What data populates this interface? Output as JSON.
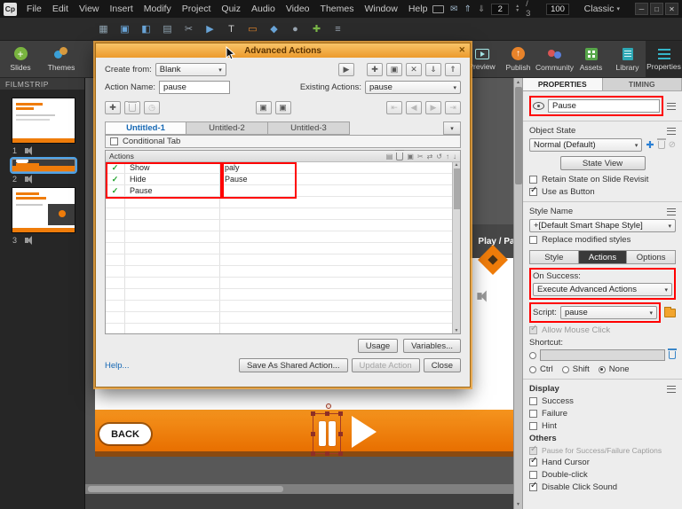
{
  "icons": {
    "dropdown": "▾",
    "check": "✓",
    "play": "▶",
    "plus": "✚",
    "copy": "▣",
    "delete": "✕",
    "clock": "◷",
    "cut": "✂",
    "undo": "↺",
    "list": "▤",
    "swap": "⇄",
    "slash": "⊘",
    "nav_first": "⇤",
    "nav_prev": "◀",
    "nav_next": "▶",
    "nav_last": "⇥",
    "up": "↑",
    "down": "↓",
    "import": "⇓",
    "export": "⇑",
    "mail": "✉",
    "win_min": "─",
    "win_max": "□",
    "win_close": "✕",
    "scroll_up": "▲",
    "scroll_down": "▼",
    "step_up": "▲",
    "step_down": "▼"
  },
  "quick_icons": [
    "▦",
    "▣",
    "◧",
    "▤",
    "✂",
    "▶",
    "T",
    "▭",
    "◆",
    "●",
    "✚",
    "≡"
  ],
  "menubar": {
    "logo": "Cp",
    "items": [
      "File",
      "Edit",
      "View",
      "Insert",
      "Modify",
      "Project",
      "Quiz",
      "Audio",
      "Video",
      "Themes",
      "Window",
      "Help"
    ],
    "slide_current": "2",
    "slide_total": "/ 3",
    "zoom": "100",
    "workspace": "Classic"
  },
  "toolbar": {
    "slides": "Slides",
    "themes": "Themes",
    "preview": "Preview",
    "publish": "Publish",
    "community": "Community",
    "assets": "Assets",
    "library": "Library",
    "properties": "Properties"
  },
  "filmstrip": {
    "title": "FILMSTRIP",
    "slide1_num": "1",
    "slide2_num": "2",
    "slide3_num": "3"
  },
  "canvas": {
    "back_label": "BACK",
    "banner_label": "Play / Pa"
  },
  "dialog": {
    "title": "Advanced Actions",
    "create_from_label": "Create from:",
    "create_from_value": "Blank",
    "action_name_label": "Action Name:",
    "action_name_value": "pause",
    "existing_actions_label": "Existing Actions:",
    "existing_actions_value": "pause",
    "tab1": "Untitled-1",
    "tab2": "Untitled-2",
    "tab3": "Untitled-3",
    "conditional_label": "Conditional Tab",
    "actions_header": "Actions",
    "rows": [
      {
        "action": "Show",
        "param": "paly"
      },
      {
        "action": "Hide",
        "param": "Pause"
      },
      {
        "action": "Pause",
        "param": ""
      }
    ],
    "usage_btn": "Usage",
    "variables_btn": "Variables...",
    "help_link": "Help...",
    "save_shared_btn": "Save As Shared Action...",
    "update_btn": "Update Action",
    "close_btn": "Close"
  },
  "props": {
    "tab_properties": "PROPERTIES",
    "tab_timing": "TIMING",
    "name_value": "Pause",
    "object_state_title": "Object State",
    "state_value": "Normal (Default)",
    "state_view_btn": "State View",
    "retain_label": "Retain State on Slide Revisit",
    "use_as_button_label": "Use as Button",
    "style_name_title": "Style Name",
    "style_value": "+[Default Smart Shape Style]",
    "replace_label": "Replace modified styles",
    "subtab_style": "Style",
    "subtab_actions": "Actions",
    "subtab_options": "Options",
    "on_success_label": "On Success:",
    "on_success_value": "Execute Advanced Actions",
    "script_label": "Script:",
    "script_value": "pause",
    "allow_mouse_label": "Allow Mouse Click",
    "shortcut_label": "Shortcut:",
    "ctrl_label": "Ctrl",
    "shift_label": "Shift",
    "none_label": "None",
    "display_title": "Display",
    "success_label": "Success",
    "failure_label": "Failure",
    "hint_label": "Hint",
    "others_title": "Others",
    "pause_captions_label": "Pause for Success/Failure Captions",
    "hand_cursor_label": "Hand Cursor",
    "double_click_label": "Double-click",
    "disable_sound_label": "Disable Click Sound"
  }
}
